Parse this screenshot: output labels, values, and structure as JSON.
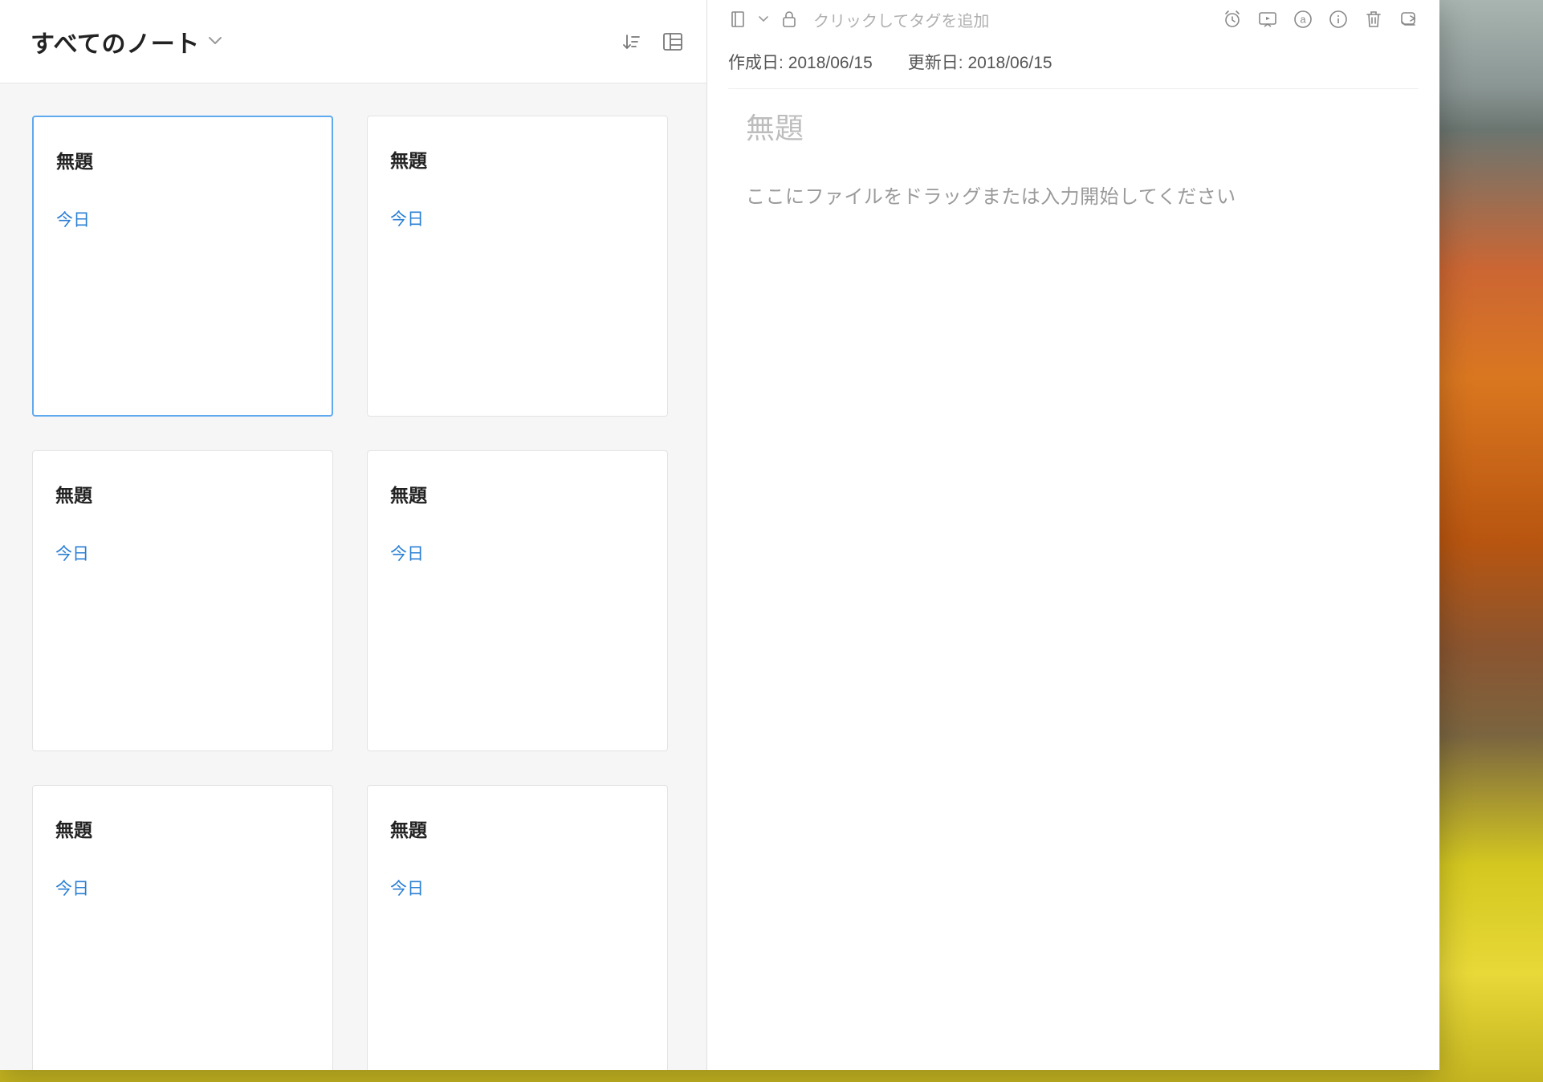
{
  "list": {
    "title": "すべてのノート",
    "notes": [
      {
        "title": "無題",
        "date": "今日",
        "selected": true
      },
      {
        "title": "無題",
        "date": "今日",
        "selected": false
      },
      {
        "title": "無題",
        "date": "今日",
        "selected": false
      },
      {
        "title": "無題",
        "date": "今日",
        "selected": false
      },
      {
        "title": "無題",
        "date": "今日",
        "selected": false
      },
      {
        "title": "無題",
        "date": "今日",
        "selected": false
      }
    ]
  },
  "detail": {
    "tag_placeholder": "クリックしてタグを追加",
    "created_label": "作成日:",
    "created_value": "2018/06/15",
    "updated_label": "更新日:",
    "updated_value": "2018/06/15",
    "title_placeholder": "無題",
    "body_placeholder": "ここにファイルをドラッグまたは入力開始してください"
  },
  "icons": {
    "sort": "sort-icon",
    "layout": "layout-grid-icon",
    "notebook": "notebook-icon",
    "lock": "lock-icon",
    "reminder": "reminder-icon",
    "present": "presentation-icon",
    "annotate": "annotate-icon",
    "info": "info-icon",
    "trash": "trash-icon",
    "share": "share-icon"
  }
}
